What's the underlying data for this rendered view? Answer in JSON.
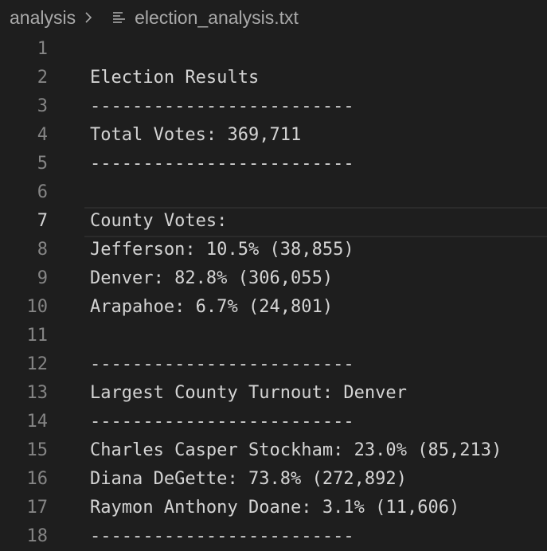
{
  "breadcrumb": {
    "folder": "analysis",
    "file": "election_analysis.txt",
    "separator_icon": "chevron-right-icon",
    "file_icon": "text-file-icon"
  },
  "editor": {
    "active_line": 7,
    "lines": [
      {
        "number": "1",
        "text": ""
      },
      {
        "number": "2",
        "text": "Election Results"
      },
      {
        "number": "3",
        "text": "-------------------------"
      },
      {
        "number": "4",
        "text": "Total Votes: 369,711"
      },
      {
        "number": "5",
        "text": "-------------------------"
      },
      {
        "number": "6",
        "text": ""
      },
      {
        "number": "7",
        "text": "County Votes:"
      },
      {
        "number": "8",
        "text": "Jefferson: 10.5% (38,855)"
      },
      {
        "number": "9",
        "text": "Denver: 82.8% (306,055)"
      },
      {
        "number": "10",
        "text": "Arapahoe: 6.7% (24,801)"
      },
      {
        "number": "11",
        "text": ""
      },
      {
        "number": "12",
        "text": "-------------------------"
      },
      {
        "number": "13",
        "text": "Largest County Turnout: Denver"
      },
      {
        "number": "14",
        "text": "-------------------------"
      },
      {
        "number": "15",
        "text": "Charles Casper Stockham: 23.0% (85,213)"
      },
      {
        "number": "16",
        "text": "Diana DeGette: 73.8% (272,892)"
      },
      {
        "number": "17",
        "text": "Raymon Anthony Doane: 3.1% (11,606)"
      },
      {
        "number": "18",
        "text": "-------------------------"
      }
    ]
  }
}
